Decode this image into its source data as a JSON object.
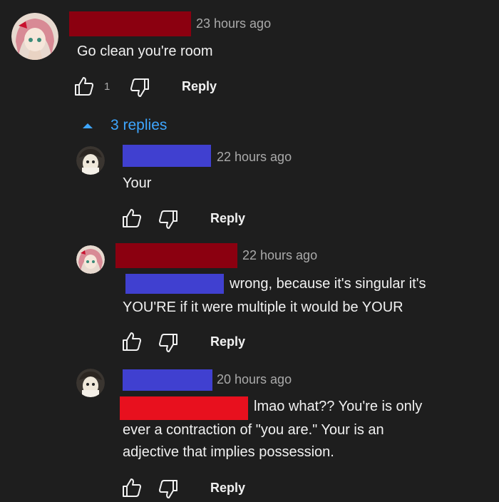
{
  "colors": {
    "background": "#1e1e1e",
    "redact_dark_red": "#8b0010",
    "redact_blue": "#4040d0",
    "redact_red": "#e8101e",
    "link_blue": "#3ea6ff"
  },
  "comment": {
    "timestamp": "23 hours ago",
    "text": "Go clean you're room",
    "like_count": "1",
    "reply_label": "Reply"
  },
  "replies_toggle": {
    "label": "3 replies"
  },
  "replies": [
    {
      "timestamp": "22 hours ago",
      "lines": [
        "Your"
      ],
      "reply_label": "Reply"
    },
    {
      "timestamp": "22 hours ago",
      "lines": [
        "wrong, because it's singular it's",
        "YOU'RE if it were multiple it would be YOUR"
      ],
      "reply_label": "Reply"
    },
    {
      "timestamp": "20 hours ago",
      "lines": [
        "lmao what?? You're is only",
        "ever a contraction of \"you are.\" Your is an",
        "adjective that implies possession."
      ],
      "reply_label": "Reply"
    }
  ],
  "icons": {
    "like": "thumbs-up-icon",
    "dislike": "thumbs-down-icon",
    "expand": "caret-up-icon"
  }
}
